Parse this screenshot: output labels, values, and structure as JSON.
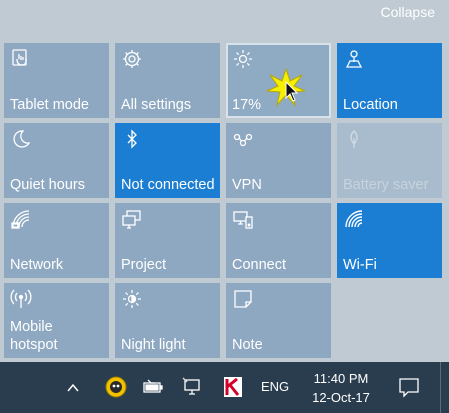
{
  "action_center": {
    "collapse_label": "Collapse",
    "tiles": [
      {
        "label": "Tablet mode",
        "icon": "tablet-mode-icon",
        "state": "off"
      },
      {
        "label": "All settings",
        "icon": "gear-icon",
        "state": "off"
      },
      {
        "label": "17%",
        "icon": "brightness-icon",
        "state": "selected"
      },
      {
        "label": "Location",
        "icon": "location-icon",
        "state": "on"
      },
      {
        "label": "Quiet hours",
        "icon": "moon-icon",
        "state": "off"
      },
      {
        "label": "Not connected",
        "icon": "bluetooth-icon",
        "state": "on"
      },
      {
        "label": "VPN",
        "icon": "vpn-icon",
        "state": "off"
      },
      {
        "label": "Battery saver",
        "icon": "leaf-icon",
        "state": "disabled"
      },
      {
        "label": "Network",
        "icon": "network-icon",
        "state": "off"
      },
      {
        "label": "Project",
        "icon": "project-icon",
        "state": "off"
      },
      {
        "label": "Connect",
        "icon": "connect-icon",
        "state": "off"
      },
      {
        "label": "Wi-Fi",
        "icon": "wifi-icon",
        "state": "on"
      },
      {
        "label": "Mobile\nhotspot",
        "icon": "mobile-hotspot-icon",
        "state": "off"
      },
      {
        "label": "Night light",
        "icon": "night-light-icon",
        "state": "off"
      },
      {
        "label": "Note",
        "icon": "note-icon",
        "state": "off"
      }
    ]
  },
  "taskbar": {
    "language": "ENG",
    "time": "11:40 PM",
    "date": "12-Oct-17"
  },
  "colors": {
    "accent": "#1b7ed3",
    "tile_off": "#8ea8c2",
    "panel_bg": "#bfcad3",
    "taskbar_bg": "#2a3d4e"
  }
}
